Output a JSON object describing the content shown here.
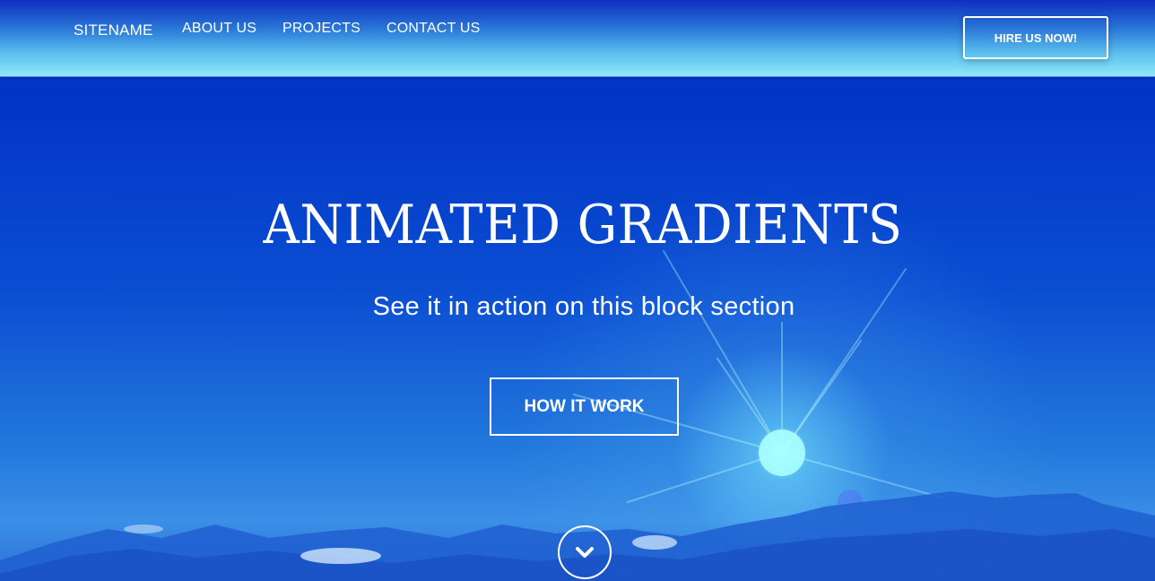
{
  "navbar": {
    "brand": "SITENAME",
    "links": [
      {
        "label": "ABOUT US"
      },
      {
        "label": "PROJECTS"
      },
      {
        "label": "CONTACT US"
      }
    ],
    "cta_label": "HIRE US NOW!"
  },
  "hero": {
    "title": "ANIMATED GRADIENTS",
    "subtitle": "See it in action on this block section",
    "button_label": "HOW IT WORK",
    "scroll_icon": "chevron-down-icon"
  },
  "colors": {
    "primary_blue": "#0436c4",
    "sky_light": "#8fe8f8",
    "sun_glow": "#96ffff",
    "text": "#ffffff"
  }
}
